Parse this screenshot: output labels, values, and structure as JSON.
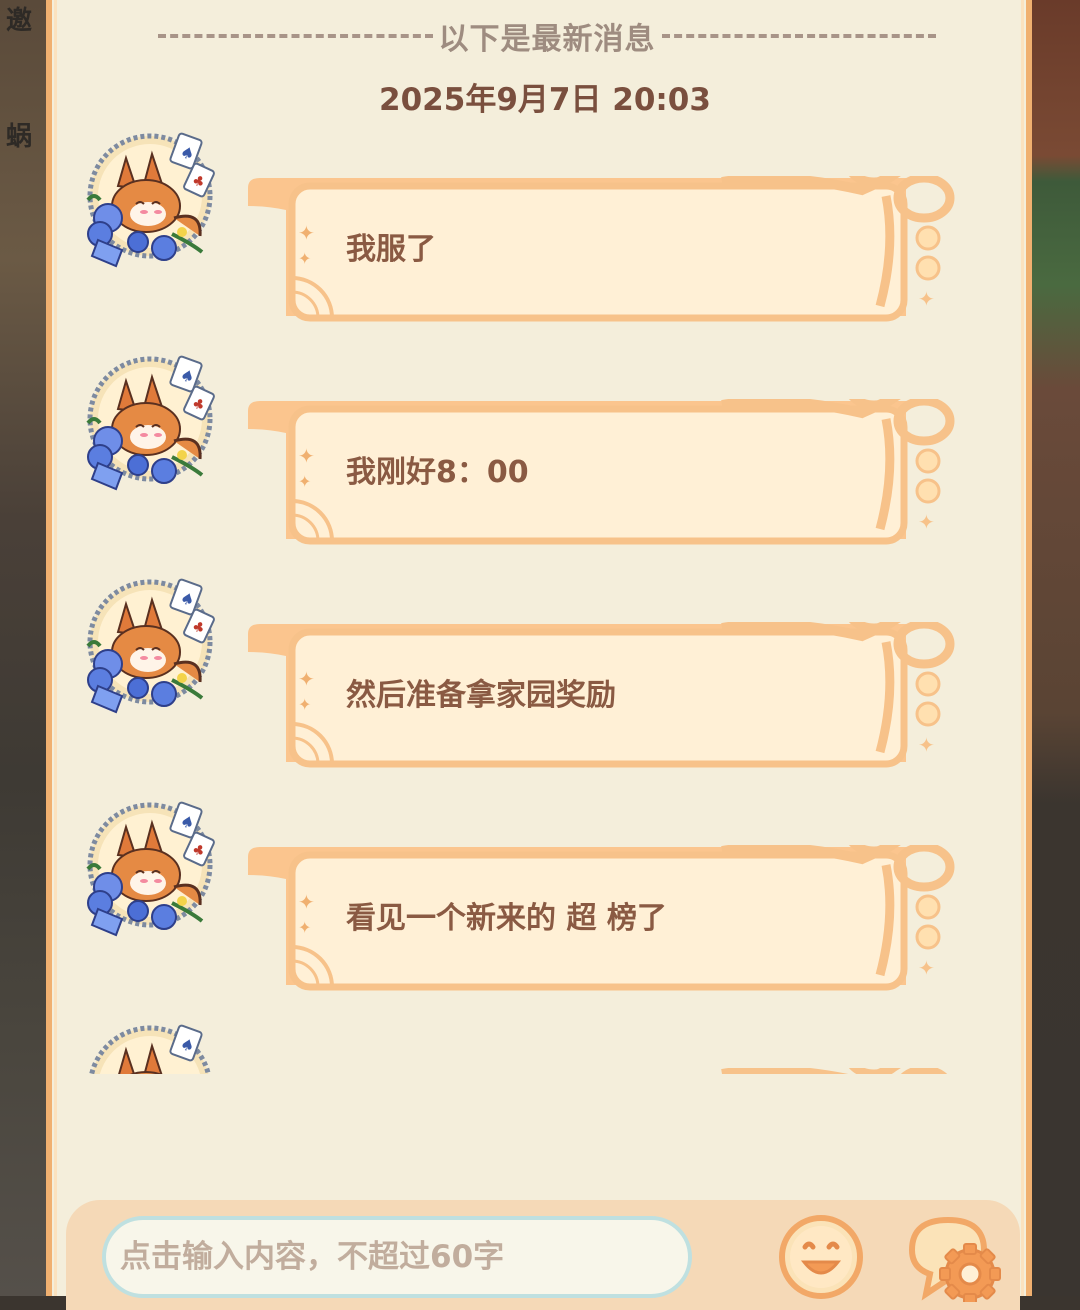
{
  "background": {
    "left_labels": [
      "邀",
      "蜗"
    ]
  },
  "chat": {
    "divider_text": "以下是最新消息",
    "timestamp": "2025年9月7日 20:03",
    "messages": [
      {
        "text": "我服了"
      },
      {
        "text": "我刚好8：00"
      },
      {
        "text": "然后准备拿家园奖励"
      },
      {
        "text": "看见一个新来的 超 榜了"
      },
      {
        "text": ""
      }
    ]
  },
  "input": {
    "placeholder": "点击输入内容，不超过60字"
  },
  "icons": {
    "avatar": "fox-avatar-icon",
    "emoji": "smiley-face-icon",
    "settings": "chat-settings-gear-icon"
  },
  "colors": {
    "panel_bg": "#f4eedb",
    "panel_border": "#f0b070",
    "bubble_fill": "#fff0d6",
    "bubble_border": "#f7c28a",
    "text_brown": "#8a5a43",
    "divider_gray": "#9e8c80"
  }
}
